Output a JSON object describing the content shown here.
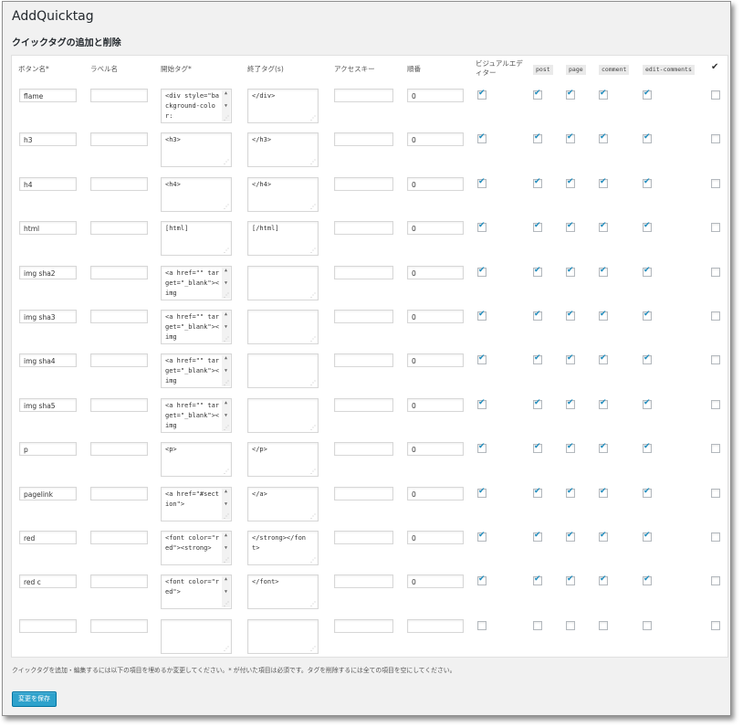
{
  "app_title": "AddQuicktag",
  "section_title": "クイックタグの追加と削除",
  "columns": {
    "button_name": "ボタン名*",
    "label_name": "ラベル名",
    "start_tag": "開始タグ*",
    "end_tag": "終了タグ(s)",
    "access_key": "アクセスキー",
    "order": "順番",
    "visual_editor": "ビジュアルエディター",
    "post": "post",
    "page": "page",
    "comment": "comment",
    "edit_comments": "edit-comments",
    "select_all": "✔"
  },
  "rows": [
    {
      "button_name": "flame",
      "label": "",
      "start_tag": "<div style=\"background-color:",
      "end_tag": "</div>",
      "access_key": "",
      "order": "0",
      "start_scroll": true,
      "visual": true,
      "post": true,
      "page": true,
      "comment": true,
      "edit_comments": true,
      "select": false
    },
    {
      "button_name": "h3",
      "label": "",
      "start_tag": "<h3>",
      "end_tag": "</h3>",
      "access_key": "",
      "order": "0",
      "start_scroll": false,
      "visual": true,
      "post": true,
      "page": true,
      "comment": true,
      "edit_comments": true,
      "select": false
    },
    {
      "button_name": "h4",
      "label": "",
      "start_tag": "<h4>",
      "end_tag": "</h4>",
      "access_key": "",
      "order": "0",
      "start_scroll": false,
      "visual": true,
      "post": true,
      "page": true,
      "comment": true,
      "edit_comments": true,
      "select": false
    },
    {
      "button_name": "html",
      "label": "",
      "start_tag": "[html]",
      "end_tag": "[/html]",
      "access_key": "",
      "order": "0",
      "start_scroll": false,
      "visual": true,
      "post": true,
      "page": true,
      "comment": true,
      "edit_comments": true,
      "select": false
    },
    {
      "button_name": "img sha2",
      "label": "",
      "start_tag": "<a href=\"\" target=\"_blank\"><img",
      "end_tag": "",
      "access_key": "",
      "order": "0",
      "start_scroll": true,
      "visual": true,
      "post": true,
      "page": true,
      "comment": true,
      "edit_comments": true,
      "select": false
    },
    {
      "button_name": "img sha3",
      "label": "",
      "start_tag": "<a href=\"\" target=\"_blank\"><img",
      "end_tag": "",
      "access_key": "",
      "order": "0",
      "start_scroll": true,
      "visual": true,
      "post": true,
      "page": true,
      "comment": true,
      "edit_comments": true,
      "select": false
    },
    {
      "button_name": "img sha4",
      "label": "",
      "start_tag": "<a href=\"\" target=\"_blank\"><img",
      "end_tag": "",
      "access_key": "",
      "order": "0",
      "start_scroll": true,
      "visual": true,
      "post": true,
      "page": true,
      "comment": true,
      "edit_comments": true,
      "select": false
    },
    {
      "button_name": "img sha5",
      "label": "",
      "start_tag": "<a href=\"\" target=\"_blank\"><img",
      "end_tag": "",
      "access_key": "",
      "order": "0",
      "start_scroll": true,
      "visual": true,
      "post": true,
      "page": true,
      "comment": true,
      "edit_comments": true,
      "select": false
    },
    {
      "button_name": "p",
      "label": "",
      "start_tag": "<p>",
      "end_tag": "</p>",
      "access_key": "",
      "order": "0",
      "start_scroll": false,
      "visual": true,
      "post": true,
      "page": true,
      "comment": true,
      "edit_comments": true,
      "select": false
    },
    {
      "button_name": "pagelink",
      "label": "",
      "start_tag": "<a href=\"#section\">",
      "end_tag": "</a>",
      "access_key": "",
      "order": "0",
      "start_scroll": true,
      "visual": true,
      "post": true,
      "page": true,
      "comment": true,
      "edit_comments": true,
      "select": false
    },
    {
      "button_name": "red",
      "label": "",
      "start_tag": "<font color=\"red\"><strong>",
      "end_tag": "</strong></font>",
      "access_key": "",
      "order": "0",
      "start_scroll": true,
      "visual": true,
      "post": true,
      "page": true,
      "comment": true,
      "edit_comments": true,
      "select": false
    },
    {
      "button_name": "red c",
      "label": "",
      "start_tag": "<font color=\"red\">",
      "end_tag": "</font>",
      "access_key": "",
      "order": "0",
      "start_scroll": true,
      "visual": true,
      "post": true,
      "page": true,
      "comment": true,
      "edit_comments": true,
      "select": false
    },
    {
      "button_name": "",
      "label": "",
      "start_tag": "",
      "end_tag": "",
      "access_key": "",
      "order": "",
      "start_scroll": false,
      "visual": false,
      "post": false,
      "page": false,
      "comment": false,
      "edit_comments": false,
      "select": false
    }
  ],
  "help_text": "クイックタグを追加・編集するには以下の項目を埋めるか変更してください。* が付いた項目は必須です。タグを削除するには全ての項目を空にしてください。",
  "save_button": "変更を保存",
  "colors": {
    "accent": "#2ea2cc",
    "checkmark": "#1e8cbe",
    "panel_bg": "#f1f1f1"
  }
}
